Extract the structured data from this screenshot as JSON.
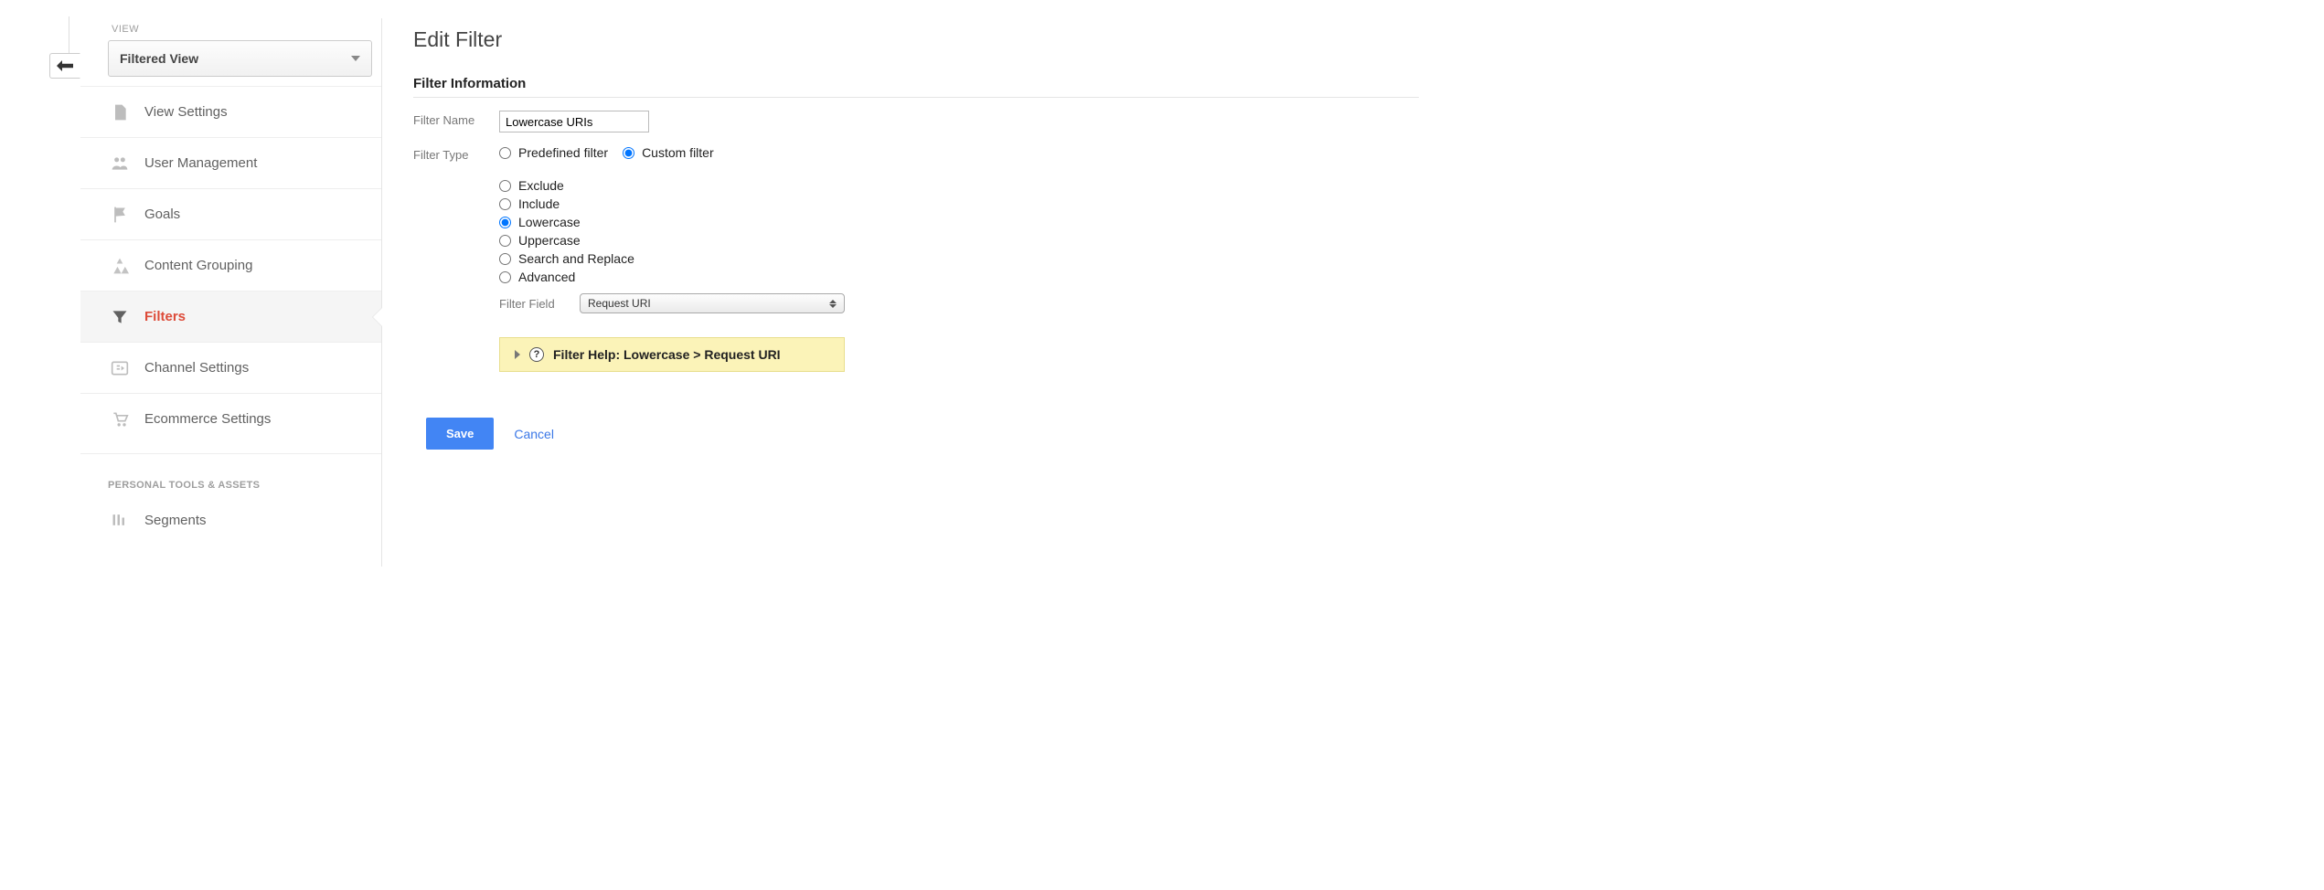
{
  "sidebar": {
    "view_label": "VIEW",
    "view_selected": "Filtered View",
    "items": [
      {
        "label": "View Settings",
        "icon": "file-icon"
      },
      {
        "label": "User Management",
        "icon": "users-icon"
      },
      {
        "label": "Goals",
        "icon": "flag-icon"
      },
      {
        "label": "Content Grouping",
        "icon": "grouping-icon"
      },
      {
        "label": "Filters",
        "icon": "funnel-icon",
        "active": true
      },
      {
        "label": "Channel Settings",
        "icon": "channels-icon"
      },
      {
        "label": "Ecommerce Settings",
        "icon": "cart-icon"
      }
    ],
    "section_header": "PERSONAL TOOLS & ASSETS",
    "section_items": [
      {
        "label": "Segments",
        "icon": "segments-icon"
      }
    ]
  },
  "main": {
    "title": "Edit Filter",
    "section": "Filter Information",
    "name_label": "Filter Name",
    "name_value": "Lowercase URIs",
    "type_label": "Filter Type",
    "type_options": {
      "predefined": "Predefined filter",
      "custom": "Custom filter"
    },
    "type_selected": "custom",
    "subtypes": [
      "Exclude",
      "Include",
      "Lowercase",
      "Uppercase",
      "Search and Replace",
      "Advanced"
    ],
    "subtype_selected": "Lowercase",
    "field_label": "Filter Field",
    "field_value": "Request URI",
    "help_text": "Filter Help: Lowercase  >  Request URI",
    "save": "Save",
    "cancel": "Cancel"
  }
}
